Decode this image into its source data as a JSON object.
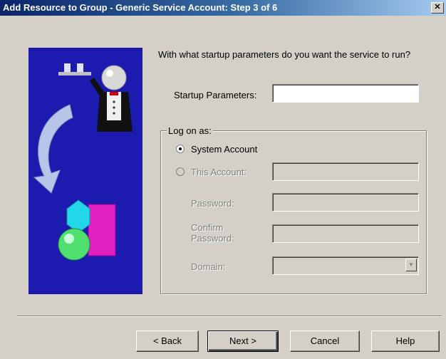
{
  "window": {
    "title": "Add Resource to Group - Generic Service Account:  Step 3 of 6",
    "close_glyph": "✕"
  },
  "content": {
    "question": "With what startup parameters do you want the service to run?",
    "startup_parameters_label": "Startup Parameters:",
    "startup_parameters_value": ""
  },
  "logon": {
    "group_label": "Log on as:",
    "system_account_label": "System Account",
    "system_account_selected": true,
    "this_account_label": "This Account:",
    "this_account_value": "",
    "password_label": "Password:",
    "password_value": "",
    "confirm_password_label_1": "Confirm",
    "confirm_password_label_2": "Password:",
    "confirm_password_value": "",
    "domain_label": "Domain:",
    "domain_value": "",
    "dropdown_glyph": "▼"
  },
  "buttons": {
    "back": "< Back",
    "next": "Next >",
    "cancel": "Cancel",
    "help": "Help"
  },
  "icons": [
    "close-icon",
    "butler-illustration",
    "chevron-down-icon"
  ],
  "colors": {
    "titlebar_start": "#0a246a",
    "titlebar_end": "#a6caf0",
    "dialog_bg": "#d4d0c8",
    "art_bg": "#1d1ab0"
  }
}
